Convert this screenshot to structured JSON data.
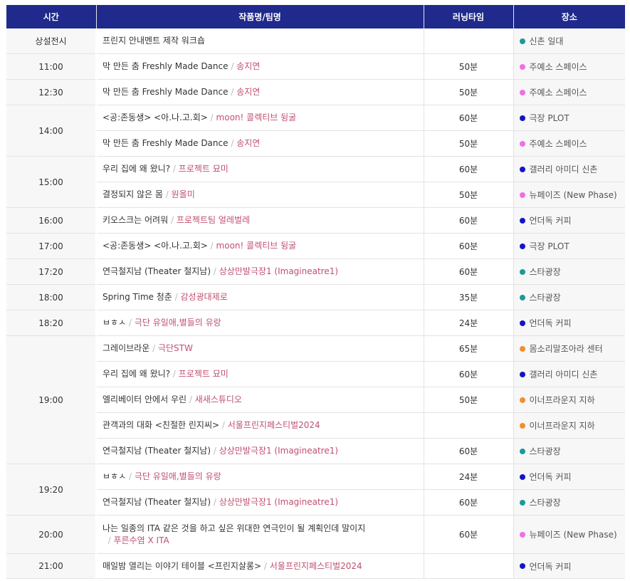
{
  "headers": {
    "time": "시간",
    "work": "작품명/팀명",
    "run": "러닝타임",
    "place": "장소"
  },
  "colors": {
    "header_bg": "#1f2a8c",
    "artist": "#c0506f",
    "teal": "#1a9a9a",
    "pink": "#f06ee6",
    "blue": "#1414c8",
    "orange": "#f0902c"
  },
  "rows": [
    {
      "time": "상설전시",
      "title": "프린지 안내멘트 제작 워크숍",
      "artist": "",
      "run": "",
      "place": "신촌 일대",
      "dot": "teal"
    },
    {
      "time": "11:00",
      "title": "막 만든 춤 Freshly Made Dance",
      "artist": "송지연",
      "run": "50분",
      "place": "주예소 스페이스",
      "dot": "pink"
    },
    {
      "time": "12:30",
      "title": "막 만든 춤 Freshly Made Dance",
      "artist": "송지연",
      "run": "50분",
      "place": "주예소 스페이스",
      "dot": "pink"
    },
    {
      "time": "14:00",
      "title": "<공:존동생> <아.나.고.회>",
      "artist": "moon! 콜렉티브 뒹굴",
      "run": "60분",
      "place": "극장 PLOT",
      "dot": "blue"
    },
    {
      "time": "",
      "title": "막 만든 춤 Freshly Made Dance",
      "artist": "송지연",
      "run": "50분",
      "place": "주예소 스페이스",
      "dot": "pink"
    },
    {
      "time": "15:00",
      "title": "우리 집에 왜 왔니?",
      "artist": "프로젝트 묘미",
      "run": "60분",
      "place": "갤러리 아미디 신촌",
      "dot": "blue"
    },
    {
      "time": "",
      "title": "결정되지 않은 몸",
      "artist": "원올미",
      "run": "50분",
      "place": "뉴페이즈 (New Phase)",
      "dot": "pink"
    },
    {
      "time": "16:00",
      "title": "키오스크는 어려워",
      "artist": "프로젝트팀 얼레벌레",
      "run": "60분",
      "place": "언더독 커피",
      "dot": "blue"
    },
    {
      "time": "17:00",
      "title": "<공:존동생> <아.나.고.회>",
      "artist": "moon! 콜렉티브 뒹굴",
      "run": "60분",
      "place": "극장 PLOT",
      "dot": "blue"
    },
    {
      "time": "17:20",
      "title": "연극철지남 (Theater 철지남)",
      "artist": "상상만발극장1 (Imagineatre1)",
      "run": "60분",
      "place": "스타광장",
      "dot": "teal"
    },
    {
      "time": "18:00",
      "title": "Spring Time 청춘",
      "artist": "감성광대제로",
      "run": "35분",
      "place": "스타광장",
      "dot": "teal"
    },
    {
      "time": "18:20",
      "title": "ㅂㅎㅅ",
      "artist": "극단 유일애,별들의 유랑",
      "run": "24분",
      "place": "언더독 커피",
      "dot": "blue"
    },
    {
      "time": "19:00",
      "title": "그레이브라운",
      "artist": "극단STW",
      "run": "65분",
      "place": "몸소리말조아라 센터",
      "dot": "orange"
    },
    {
      "time": "",
      "title": "우리 집에 왜 왔니?",
      "artist": "프로젝트 묘미",
      "run": "60분",
      "place": "갤러리 아미디 신촌",
      "dot": "blue"
    },
    {
      "time": "",
      "title": "엘리베이터 안에서 우린",
      "artist": "새새스튜디오",
      "run": "50분",
      "place": "이너프라운지 지하",
      "dot": "orange"
    },
    {
      "time": "",
      "title": "관객과의 대화 <친절한 린지씨>",
      "artist": "서울프린지페스티벌2024",
      "run": "",
      "place": "이너프라운지 지하",
      "dot": "orange"
    },
    {
      "time": "",
      "title": "연극철지남 (Theater 철지남)",
      "artist": "상상만발극장1 (Imagineatre1)",
      "run": "60분",
      "place": "스타광장",
      "dot": "teal"
    },
    {
      "time": "19:20",
      "title": "ㅂㅎㅅ",
      "artist": "극단 유일애,별들의 유랑",
      "run": "24분",
      "place": "언더독 커피",
      "dot": "blue"
    },
    {
      "time": "",
      "title": "연극철지남 (Theater 철지남)",
      "artist": "상상만발극장1 (Imagineatre1)",
      "run": "60분",
      "place": "스타광장",
      "dot": "teal"
    },
    {
      "time": "20:00",
      "title": "나는 일종의 ITA 같은 것을 하고 싶은 위대한 연극인이 될 계획인데 말이지",
      "artist": "푸른수염 X ITA",
      "run": "60분",
      "place": "뉴페이즈 (New Phase)",
      "dot": "pink"
    },
    {
      "time": "21:00",
      "title": "매일밤 열리는 이야기 테이블 <프린지살롱>",
      "artist": "서울프린지페스티벌2024",
      "run": "",
      "place": "언더독 커피",
      "dot": "blue"
    }
  ]
}
